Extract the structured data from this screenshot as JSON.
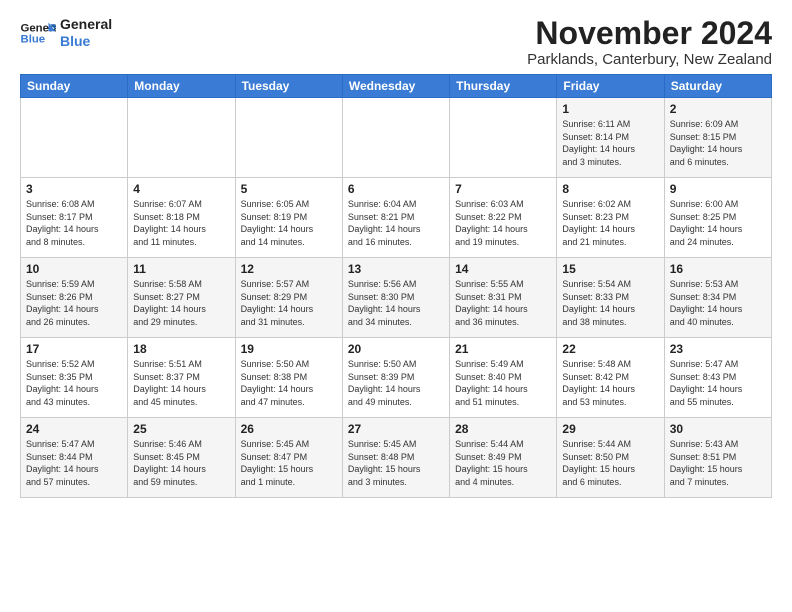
{
  "logo": {
    "line1": "General",
    "line2": "Blue"
  },
  "title": "November 2024",
  "subtitle": "Parklands, Canterbury, New Zealand",
  "weekdays": [
    "Sunday",
    "Monday",
    "Tuesday",
    "Wednesday",
    "Thursday",
    "Friday",
    "Saturday"
  ],
  "weeks": [
    [
      {
        "day": "",
        "info": ""
      },
      {
        "day": "",
        "info": ""
      },
      {
        "day": "",
        "info": ""
      },
      {
        "day": "",
        "info": ""
      },
      {
        "day": "",
        "info": ""
      },
      {
        "day": "1",
        "info": "Sunrise: 6:11 AM\nSunset: 8:14 PM\nDaylight: 14 hours\nand 3 minutes."
      },
      {
        "day": "2",
        "info": "Sunrise: 6:09 AM\nSunset: 8:15 PM\nDaylight: 14 hours\nand 6 minutes."
      }
    ],
    [
      {
        "day": "3",
        "info": "Sunrise: 6:08 AM\nSunset: 8:17 PM\nDaylight: 14 hours\nand 8 minutes."
      },
      {
        "day": "4",
        "info": "Sunrise: 6:07 AM\nSunset: 8:18 PM\nDaylight: 14 hours\nand 11 minutes."
      },
      {
        "day": "5",
        "info": "Sunrise: 6:05 AM\nSunset: 8:19 PM\nDaylight: 14 hours\nand 14 minutes."
      },
      {
        "day": "6",
        "info": "Sunrise: 6:04 AM\nSunset: 8:21 PM\nDaylight: 14 hours\nand 16 minutes."
      },
      {
        "day": "7",
        "info": "Sunrise: 6:03 AM\nSunset: 8:22 PM\nDaylight: 14 hours\nand 19 minutes."
      },
      {
        "day": "8",
        "info": "Sunrise: 6:02 AM\nSunset: 8:23 PM\nDaylight: 14 hours\nand 21 minutes."
      },
      {
        "day": "9",
        "info": "Sunrise: 6:00 AM\nSunset: 8:25 PM\nDaylight: 14 hours\nand 24 minutes."
      }
    ],
    [
      {
        "day": "10",
        "info": "Sunrise: 5:59 AM\nSunset: 8:26 PM\nDaylight: 14 hours\nand 26 minutes."
      },
      {
        "day": "11",
        "info": "Sunrise: 5:58 AM\nSunset: 8:27 PM\nDaylight: 14 hours\nand 29 minutes."
      },
      {
        "day": "12",
        "info": "Sunrise: 5:57 AM\nSunset: 8:29 PM\nDaylight: 14 hours\nand 31 minutes."
      },
      {
        "day": "13",
        "info": "Sunrise: 5:56 AM\nSunset: 8:30 PM\nDaylight: 14 hours\nand 34 minutes."
      },
      {
        "day": "14",
        "info": "Sunrise: 5:55 AM\nSunset: 8:31 PM\nDaylight: 14 hours\nand 36 minutes."
      },
      {
        "day": "15",
        "info": "Sunrise: 5:54 AM\nSunset: 8:33 PM\nDaylight: 14 hours\nand 38 minutes."
      },
      {
        "day": "16",
        "info": "Sunrise: 5:53 AM\nSunset: 8:34 PM\nDaylight: 14 hours\nand 40 minutes."
      }
    ],
    [
      {
        "day": "17",
        "info": "Sunrise: 5:52 AM\nSunset: 8:35 PM\nDaylight: 14 hours\nand 43 minutes."
      },
      {
        "day": "18",
        "info": "Sunrise: 5:51 AM\nSunset: 8:37 PM\nDaylight: 14 hours\nand 45 minutes."
      },
      {
        "day": "19",
        "info": "Sunrise: 5:50 AM\nSunset: 8:38 PM\nDaylight: 14 hours\nand 47 minutes."
      },
      {
        "day": "20",
        "info": "Sunrise: 5:50 AM\nSunset: 8:39 PM\nDaylight: 14 hours\nand 49 minutes."
      },
      {
        "day": "21",
        "info": "Sunrise: 5:49 AM\nSunset: 8:40 PM\nDaylight: 14 hours\nand 51 minutes."
      },
      {
        "day": "22",
        "info": "Sunrise: 5:48 AM\nSunset: 8:42 PM\nDaylight: 14 hours\nand 53 minutes."
      },
      {
        "day": "23",
        "info": "Sunrise: 5:47 AM\nSunset: 8:43 PM\nDaylight: 14 hours\nand 55 minutes."
      }
    ],
    [
      {
        "day": "24",
        "info": "Sunrise: 5:47 AM\nSunset: 8:44 PM\nDaylight: 14 hours\nand 57 minutes."
      },
      {
        "day": "25",
        "info": "Sunrise: 5:46 AM\nSunset: 8:45 PM\nDaylight: 14 hours\nand 59 minutes."
      },
      {
        "day": "26",
        "info": "Sunrise: 5:45 AM\nSunset: 8:47 PM\nDaylight: 15 hours\nand 1 minute."
      },
      {
        "day": "27",
        "info": "Sunrise: 5:45 AM\nSunset: 8:48 PM\nDaylight: 15 hours\nand 3 minutes."
      },
      {
        "day": "28",
        "info": "Sunrise: 5:44 AM\nSunset: 8:49 PM\nDaylight: 15 hours\nand 4 minutes."
      },
      {
        "day": "29",
        "info": "Sunrise: 5:44 AM\nSunset: 8:50 PM\nDaylight: 15 hours\nand 6 minutes."
      },
      {
        "day": "30",
        "info": "Sunrise: 5:43 AM\nSunset: 8:51 PM\nDaylight: 15 hours\nand 7 minutes."
      }
    ]
  ]
}
